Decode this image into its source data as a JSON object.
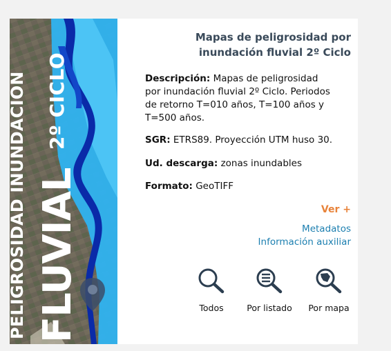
{
  "cover": {
    "line1": "PELIGROSIDAD INUNDACIÓN",
    "line2": "FLUVIAL",
    "line3": "2º CICLO"
  },
  "title": "Mapas de peligrosidad por inundación fluvial 2º Ciclo",
  "fields": {
    "descripcion_label": "Descripción:",
    "descripcion_value": "Mapas de peligrosidad por inundación fluvial 2º Ciclo. Periodos de retorno T=010 años, T=100 años y T=500 años.",
    "sgr_label": "SGR:",
    "sgr_value": "ETRS89. Proyección UTM huso 30.",
    "ud_label": "Ud. descarga:",
    "ud_value": "zonas inundables",
    "formato_label": "Formato:",
    "formato_value": "GeoTIFF"
  },
  "actions": {
    "ver_mas": "Ver +",
    "metadatos": "Metadatos",
    "info_aux": "Información auxiliar"
  },
  "tools": [
    {
      "label": "Todos",
      "icon": "search-icon"
    },
    {
      "label": "Por listado",
      "icon": "list-search-icon"
    },
    {
      "label": "Por mapa",
      "icon": "map-search-icon"
    }
  ],
  "colors": {
    "title": "#3a4a5a",
    "ver_mas": "#e8833a",
    "link": "#1c7fb0",
    "icon": "#2c3e50",
    "flood_light": "#2fb3f0",
    "flood_dark": "#0a2aa8"
  }
}
